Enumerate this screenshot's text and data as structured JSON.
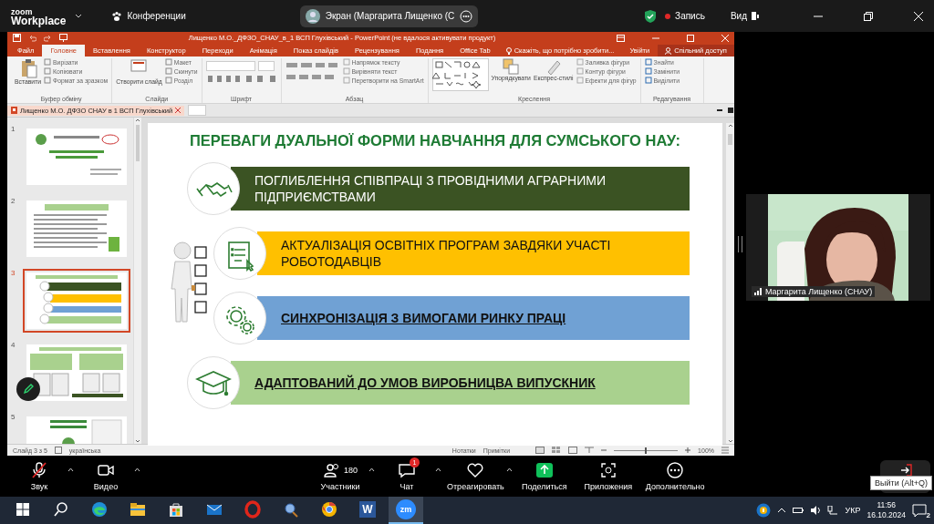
{
  "zoom_bar": {
    "app_name": "zoom",
    "app_subtitle": "Workplace",
    "meetings_label": "Конференции",
    "share_label": "Экран (Маргарита Лищенко (С",
    "recording_label": "Запись",
    "view_label": "Вид"
  },
  "powerpoint": {
    "title": "Лищенко М.О._ДФЗО_СНАУ_в_1 ВСП Глухівський - PowerPoint (не вдалося активувати продукт)",
    "ribbon_tabs": [
      {
        "label": "Файл",
        "selected": false
      },
      {
        "label": "Головне",
        "selected": true
      },
      {
        "label": "Вставлення",
        "selected": false
      },
      {
        "label": "Конструктор",
        "selected": false
      },
      {
        "label": "Переходи",
        "selected": false
      },
      {
        "label": "Анімація",
        "selected": false
      },
      {
        "label": "Показ слайдів",
        "selected": false
      },
      {
        "label": "Рецензування",
        "selected": false
      },
      {
        "label": "Подання",
        "selected": false
      },
      {
        "label": "Office Tab",
        "selected": false
      }
    ],
    "tell_me": "Скажіть, що потрібно зробити...",
    "sign_in": "Увійти",
    "share": "Спільний доступ",
    "ribbon_groups": [
      {
        "name": "Буфер обміну",
        "commands": [
          "Вставити",
          "Вирізати",
          "Копіювати",
          "Формат за зразком"
        ]
      },
      {
        "name": "Слайди",
        "commands": [
          "Створити слайд",
          "Макет",
          "Скинути",
          "Розділ"
        ]
      },
      {
        "name": "Шрифт"
      },
      {
        "name": "Абзац",
        "commands": [
          "Напрямок тексту",
          "Вирівняти текст",
          "Перетворити на SmartArt"
        ]
      },
      {
        "name": "Креслення",
        "commands": [
          "Упорядкувати",
          "Експрес-стилі",
          "Заливка фігури",
          "Контур фігури",
          "Ефекти для фігур"
        ]
      },
      {
        "name": "Редагування",
        "commands": [
          "Знайти",
          "Замінити",
          "Виділити"
        ]
      }
    ],
    "document_tab": "Лищенко М.О. ДФЗО СНАУ в 1 ВСП Глухівський",
    "thumbnails": [
      {
        "number": "1",
        "selected": false
      },
      {
        "number": "2",
        "selected": false
      },
      {
        "number": "3",
        "selected": true
      },
      {
        "number": "4",
        "selected": false
      },
      {
        "number": "5",
        "selected": false
      }
    ],
    "slide": {
      "title": "ПЕРЕВАГИ ДУАЛЬНОЇ ФОРМИ НАВЧАННЯ ДЛЯ СУМСЬКОГО НАУ:",
      "points": [
        {
          "text": "ПОГЛИБЛЕННЯ СПІВПРАЦІ З ПРОВІДНИМИ АГРАРНИМИ ПІДПРИЄМСТВАМИ",
          "color": "#3b5323",
          "emphasis": false
        },
        {
          "text": "АКТУАЛІЗАЦІЯ ОСВІТНІХ ПРОГРАМ ЗАВДЯКИ УЧАСТІ РОБОТОДАВЦІВ",
          "color": "#ffc000",
          "emphasis": false
        },
        {
          "text": "СИНХРОНІЗАЦІЯ З ВИМОГАМИ РИНКУ ПРАЦІ",
          "color": "#70a1d4",
          "emphasis": true
        },
        {
          "text": "АДАПТОВАНИЙ ДО УМОВ ВИРОБНИЦВА ВИПУСКНИК",
          "color": "#a9d18e",
          "emphasis": true
        }
      ]
    },
    "status": {
      "slide_counter": "Слайд 3 з 5",
      "language": "українська",
      "notes": "Нотатки",
      "comments": "Примітки",
      "zoom": "100%",
      "zoom_slider": {
        "level": 0.5
      }
    }
  },
  "video": {
    "name": "Маргарита Лищенко (СНАУ)"
  },
  "meeting_controls": [
    {
      "label": "Звук",
      "kind": "audio",
      "muted": true
    },
    {
      "label": "Видео",
      "kind": "video"
    },
    {
      "label": "Участники",
      "kind": "participants",
      "count": "180"
    },
    {
      "label": "Чат",
      "kind": "chat",
      "badge": "1"
    },
    {
      "label": "Отреагировать",
      "kind": "react"
    },
    {
      "label": "Поделиться",
      "kind": "share"
    },
    {
      "label": "Приложения",
      "kind": "apps"
    },
    {
      "label": "Дополнительно",
      "kind": "more"
    }
  ],
  "leave": {
    "tooltip": "Выйти (Alt+Q)"
  },
  "taskbar": {
    "apps": [
      {
        "kind": "start",
        "active": false
      },
      {
        "kind": "search",
        "active": false
      },
      {
        "kind": "edge",
        "active": false
      },
      {
        "kind": "explorer",
        "active": false
      },
      {
        "kind": "store",
        "active": false
      },
      {
        "kind": "mail",
        "active": false
      },
      {
        "kind": "opera",
        "active": false
      },
      {
        "kind": "tool",
        "active": false
      },
      {
        "kind": "chrome",
        "active": false
      },
      {
        "kind": "word",
        "label": "W",
        "active": false
      },
      {
        "kind": "zoom",
        "label": "zm",
        "active": true
      }
    ],
    "language": "УКР",
    "time": "11:56",
    "date": "16.10.2024",
    "notifications": "2"
  }
}
